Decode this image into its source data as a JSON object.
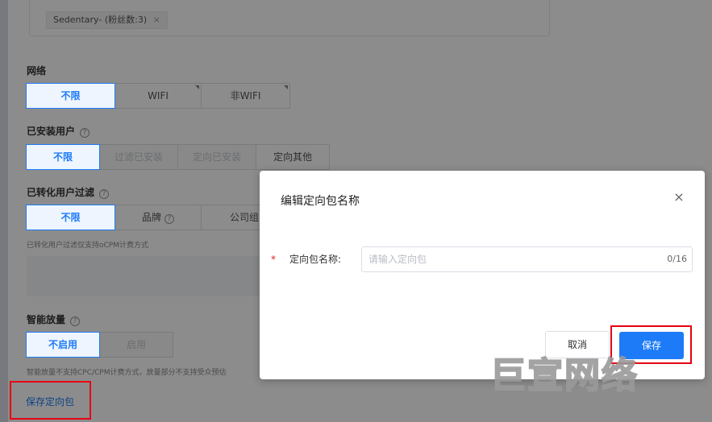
{
  "audience": {
    "tag_label": "Sedentary- (粉丝数:3)",
    "tag_close": "×"
  },
  "network": {
    "label": "网络",
    "options": [
      "不限",
      "WIFI",
      "非WIFI"
    ]
  },
  "installed": {
    "label": "已安装用户",
    "options": [
      "不限",
      "过滤已安装",
      "定向已安装",
      "定向其他"
    ]
  },
  "converted": {
    "label": "已转化用户过滤",
    "options": [
      "不限",
      "品牌",
      "公司组"
    ],
    "hint": "已转化用户过滤仅支持oCPM计费方式"
  },
  "smart": {
    "label": "智能放量",
    "options": [
      "不启用",
      "启用"
    ],
    "hint": "智能放量不支持CPC/CPM计费方式，放量部分不支持受众预估"
  },
  "save_package_link": "保存定向包",
  "help_glyph": "?",
  "modal": {
    "title": "编辑定向包名称",
    "close_glyph": "×",
    "required_mark": "*",
    "field_label": "定向包名称:",
    "field_placeholder": "请输入定向包",
    "field_counter": "0/16",
    "cancel_label": "取消",
    "save_label": "保存"
  },
  "watermark": "巨宣网络",
  "colors": {
    "primary": "#1d7bf7",
    "highlight": "#e60012",
    "overlay": "rgba(0,0,0,0.45)"
  }
}
